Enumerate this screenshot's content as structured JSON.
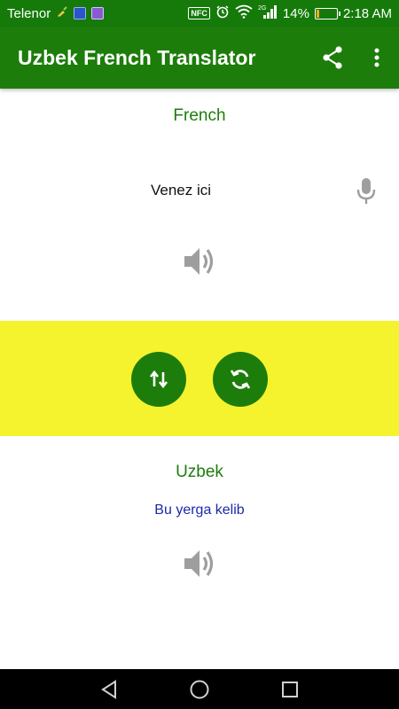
{
  "status_bar": {
    "carrier": "Telenor",
    "network_type": "2G",
    "battery_percent": "14%",
    "battery_level": 0.14,
    "time": "2:18 AM",
    "nfc_label": "NFC"
  },
  "app_bar": {
    "title": "Uzbek French Translator",
    "share_icon": "share-icon",
    "menu_icon": "more-vert-icon"
  },
  "source": {
    "language": "French",
    "text": "Venez ici",
    "mic_icon": "mic-icon",
    "speaker_icon": "volume-icon"
  },
  "controls": {
    "swap_icon": "swap-vert-icon",
    "refresh_icon": "refresh-icon"
  },
  "target": {
    "language": "Uzbek",
    "text": "Bu yerga kelib",
    "speaker_icon": "volume-icon"
  },
  "colors": {
    "primary": "#1d7d0b",
    "status_bar": "#157a0a",
    "band": "#f4f32e",
    "target_text": "#1a2aa8",
    "icon_gray": "#9e9e9e"
  },
  "nav_bar": {
    "back_icon": "back-triangle-icon",
    "home_icon": "home-circle-icon",
    "recents_icon": "recents-square-icon"
  }
}
